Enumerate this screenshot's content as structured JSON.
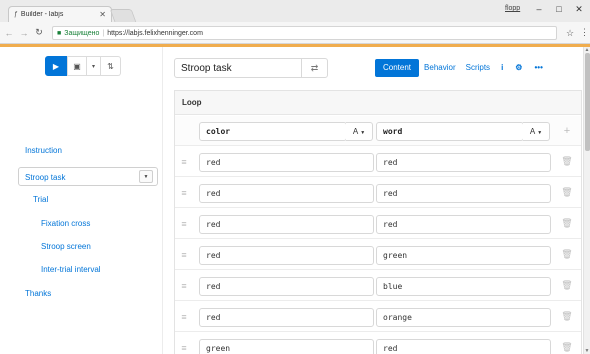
{
  "browser": {
    "tab_title": "Builder - labjs",
    "tab_icon": "flask-icon",
    "user_label": "flopp",
    "secure_text": "Защищено",
    "url": "https://labjs.felixhenninger.com"
  },
  "toolbar": {
    "run_icon": "▶",
    "save_icon": "▣",
    "caret_icon": "▾",
    "options_icon": "⇅"
  },
  "sidebar": {
    "items": [
      {
        "label": "Instruction"
      },
      {
        "label": "Stroop task"
      },
      {
        "label": "Trial"
      },
      {
        "label": "Fixation cross"
      },
      {
        "label": "Stroop screen"
      },
      {
        "label": "Inter-trial interval"
      },
      {
        "label": "Thanks"
      }
    ],
    "selected": "Stroop task"
  },
  "component": {
    "name": "Stroop task",
    "type_icon": "⇄"
  },
  "tabs": {
    "content": "Content",
    "behavior": "Behavior",
    "scripts": "Scripts",
    "info_icon": "i",
    "settings_icon": "⚙",
    "more_icon": "•••"
  },
  "loop": {
    "title": "Loop",
    "columns": [
      {
        "name": "color",
        "type": "A"
      },
      {
        "name": "word",
        "type": "A"
      }
    ],
    "rows": [
      [
        "red",
        "red"
      ],
      [
        "red",
        "red"
      ],
      [
        "red",
        "red"
      ],
      [
        "red",
        "green"
      ],
      [
        "red",
        "blue"
      ],
      [
        "red",
        "orange"
      ],
      [
        "green",
        "red"
      ]
    ]
  },
  "colors": {
    "primary": "#0275d8",
    "accent_bar": "#f0ad4e"
  }
}
